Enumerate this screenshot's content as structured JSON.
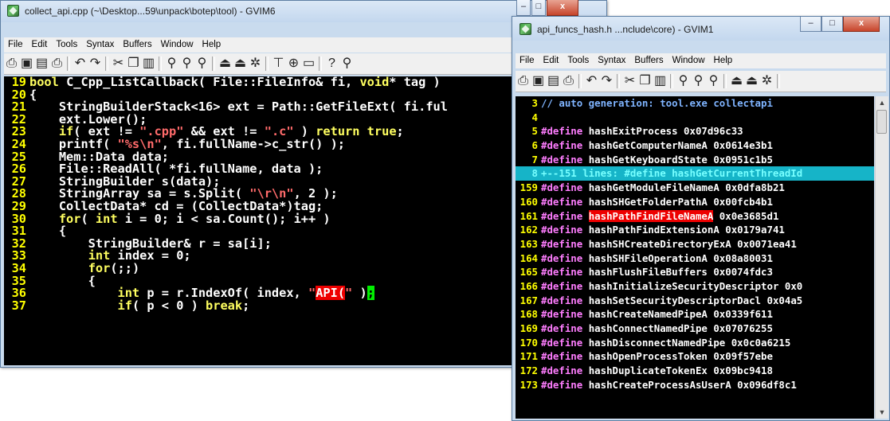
{
  "left_window": {
    "title": "collect_api.cpp (~\\Desktop...59\\unpack\\botep\\tool) - GVIM6",
    "menu": [
      "File",
      "Edit",
      "Tools",
      "Syntax",
      "Buffers",
      "Window",
      "Help"
    ],
    "toolbar_icons": [
      "open-icon",
      "save-icon",
      "save-all-icon",
      "print-icon",
      "undo-icon",
      "redo-icon",
      "cut-icon",
      "copy-icon",
      "paste-icon",
      "find-replace-icon",
      "find-next-icon",
      "find-prev-icon",
      "load-session-icon",
      "save-session-icon",
      "run-script-icon",
      "make-icon",
      "run-ctags-icon",
      "tag-jump-icon",
      "help-icon",
      "find-help-icon"
    ],
    "lines": [
      {
        "n": "19",
        "parts": [
          [
            "kw",
            "bool "
          ],
          [
            "code",
            "C_Cpp_ListCallback( File::FileInfo& fi, "
          ],
          [
            "kw",
            "void"
          ],
          [
            "code",
            "* tag )"
          ]
        ]
      },
      {
        "n": "20",
        "parts": [
          [
            "code",
            "{"
          ]
        ]
      },
      {
        "n": "21",
        "parts": [
          [
            "code",
            "    StringBuilderStack<16> ext = Path::GetFileExt( fi.ful"
          ]
        ]
      },
      {
        "n": "22",
        "parts": [
          [
            "code",
            "    ext.Lower();"
          ]
        ]
      },
      {
        "n": "23",
        "parts": [
          [
            "code",
            "    "
          ],
          [
            "kw",
            "if"
          ],
          [
            "code",
            "( ext != "
          ],
          [
            "str",
            "\".cpp\""
          ],
          [
            "code",
            " && ext != "
          ],
          [
            "str",
            "\".c\""
          ],
          [
            "code",
            " ) "
          ],
          [
            "kw",
            "return true"
          ],
          [
            "code",
            ";"
          ]
        ]
      },
      {
        "n": "24",
        "parts": [
          [
            "code",
            "    printf( "
          ],
          [
            "str",
            "\"%s\\n\""
          ],
          [
            "code",
            ", fi.fullName->c_str() );"
          ]
        ]
      },
      {
        "n": "25",
        "parts": [
          [
            "code",
            "    Mem::Data data;"
          ]
        ]
      },
      {
        "n": "26",
        "parts": [
          [
            "code",
            "    File::ReadAll( *fi.fullName, data );"
          ]
        ]
      },
      {
        "n": "27",
        "parts": [
          [
            "code",
            "    StringBuilder s(data);"
          ]
        ]
      },
      {
        "n": "28",
        "parts": [
          [
            "code",
            "    StringArray sa = s.Split( "
          ],
          [
            "str",
            "\"\\r\\n\""
          ],
          [
            "code",
            ", 2 );"
          ]
        ]
      },
      {
        "n": "29",
        "parts": [
          [
            "code",
            "    CollectData* cd = (CollectData*)tag;"
          ]
        ]
      },
      {
        "n": "30",
        "parts": [
          [
            "code",
            "    "
          ],
          [
            "kw",
            "for"
          ],
          [
            "code",
            "( "
          ],
          [
            "kw",
            "int"
          ],
          [
            "code",
            " i = 0; i < sa.Count(); i++ )"
          ]
        ]
      },
      {
        "n": "31",
        "parts": [
          [
            "code",
            "    {"
          ]
        ]
      },
      {
        "n": "32",
        "parts": [
          [
            "code",
            "        StringBuilder& r = sa[i];"
          ]
        ]
      },
      {
        "n": "33",
        "parts": [
          [
            "code",
            "        "
          ],
          [
            "kw",
            "int"
          ],
          [
            "code",
            " index = 0;"
          ]
        ]
      },
      {
        "n": "34",
        "parts": [
          [
            "code",
            "        "
          ],
          [
            "kw",
            "for"
          ],
          [
            "code",
            "(;;)"
          ]
        ]
      },
      {
        "n": "35",
        "parts": [
          [
            "code",
            "        {"
          ]
        ]
      },
      {
        "n": "36",
        "parts": [
          [
            "code",
            "            "
          ],
          [
            "kw",
            "int"
          ],
          [
            "code",
            " p = r.IndexOf( index, "
          ],
          [
            "str",
            "\""
          ],
          [
            "hl-red",
            "API("
          ],
          [
            "str",
            "\""
          ],
          [
            "code",
            " )"
          ],
          [
            "hl-green",
            ";"
          ]
        ]
      },
      {
        "n": "37",
        "parts": [
          [
            "code",
            "            "
          ],
          [
            "kw",
            "if"
          ],
          [
            "code",
            "( p < 0 ) "
          ],
          [
            "kw",
            "break"
          ],
          [
            "code",
            ";"
          ]
        ]
      }
    ]
  },
  "right_window": {
    "title": "api_funcs_hash.h ...nclude\\core) - GVIM1",
    "menu": [
      "File",
      "Edit",
      "Tools",
      "Syntax",
      "Buffers",
      "Window",
      "Help"
    ],
    "toolbar_icons": [
      "open-icon",
      "save-icon",
      "save-all-icon",
      "print-icon",
      "undo-icon",
      "redo-icon",
      "cut-icon",
      "copy-icon",
      "paste-icon",
      "find-replace-icon",
      "find-next-icon",
      "find-prev-icon",
      "load-session-icon",
      "save-session-icon",
      "run-script-icon"
    ],
    "lines": [
      {
        "n": "3",
        "parts": [
          [
            "cmt",
            "// auto generation: tool.exe collectapi"
          ]
        ]
      },
      {
        "n": "4",
        "parts": []
      },
      {
        "n": "5",
        "parts": [
          [
            "def",
            "#define "
          ],
          [
            "code",
            "hashExitProcess 0x07d96c33"
          ]
        ]
      },
      {
        "n": "6",
        "parts": [
          [
            "def",
            "#define "
          ],
          [
            "code",
            "hashGetComputerNameA 0x0614e3b1"
          ]
        ]
      },
      {
        "n": "7",
        "parts": [
          [
            "def",
            "#define "
          ],
          [
            "code",
            "hashGetKeyboardState 0x0951c1b5"
          ]
        ]
      },
      {
        "n": "8",
        "fold": true,
        "parts": [
          [
            "fold",
            "+--151 lines: #define hashGetCurrentThreadId"
          ]
        ]
      },
      {
        "n": "159",
        "parts": [
          [
            "def",
            "#define "
          ],
          [
            "code",
            "hashGetModuleFileNameA 0x0dfa8b21"
          ]
        ]
      },
      {
        "n": "160",
        "parts": [
          [
            "def",
            "#define "
          ],
          [
            "code",
            "hashSHGetFolderPathA 0x00fcb4b1"
          ]
        ]
      },
      {
        "n": "161",
        "parts": [
          [
            "def",
            "#define "
          ],
          [
            "hl-red",
            "hashPathFindFileNameA"
          ],
          [
            "code",
            " 0x0e3685d1"
          ]
        ]
      },
      {
        "n": "162",
        "parts": [
          [
            "def",
            "#define "
          ],
          [
            "code",
            "hashPathFindExtensionA 0x0179a741"
          ]
        ]
      },
      {
        "n": "163",
        "parts": [
          [
            "def",
            "#define "
          ],
          [
            "code",
            "hashSHCreateDirectoryExA 0x0071ea41"
          ]
        ]
      },
      {
        "n": "164",
        "parts": [
          [
            "def",
            "#define "
          ],
          [
            "code",
            "hashSHFileOperationA 0x08a80031"
          ]
        ]
      },
      {
        "n": "165",
        "parts": [
          [
            "def",
            "#define "
          ],
          [
            "code",
            "hashFlushFileBuffers 0x0074fdc3"
          ]
        ]
      },
      {
        "n": "166",
        "parts": [
          [
            "def",
            "#define "
          ],
          [
            "code",
            "hashInitializeSecurityDescriptor 0x0"
          ]
        ]
      },
      {
        "n": "167",
        "parts": [
          [
            "def",
            "#define "
          ],
          [
            "code",
            "hashSetSecurityDescriptorDacl 0x04a5"
          ]
        ]
      },
      {
        "n": "168",
        "parts": [
          [
            "def",
            "#define "
          ],
          [
            "code",
            "hashCreateNamedPipeA 0x0339f611"
          ]
        ]
      },
      {
        "n": "169",
        "parts": [
          [
            "def",
            "#define "
          ],
          [
            "code",
            "hashConnectNamedPipe 0x07076255"
          ]
        ]
      },
      {
        "n": "170",
        "parts": [
          [
            "def",
            "#define "
          ],
          [
            "code",
            "hashDisconnectNamedPipe 0x0c0a6215"
          ]
        ]
      },
      {
        "n": "171",
        "parts": [
          [
            "def",
            "#define "
          ],
          [
            "code",
            "hashOpenProcessToken 0x09f57ebe"
          ]
        ]
      },
      {
        "n": "172",
        "parts": [
          [
            "def",
            "#define "
          ],
          [
            "code",
            "hashDuplicateTokenEx 0x09bc9418"
          ]
        ]
      },
      {
        "n": "173",
        "parts": [
          [
            "def",
            "#define "
          ],
          [
            "code",
            "hashCreateProcessAsUserA 0x096df8c1"
          ]
        ]
      }
    ]
  },
  "caption_buttons": {
    "minimize": "–",
    "maximize": "□",
    "close": "x"
  },
  "scroll": {
    "up": "▲",
    "down": "▼"
  }
}
